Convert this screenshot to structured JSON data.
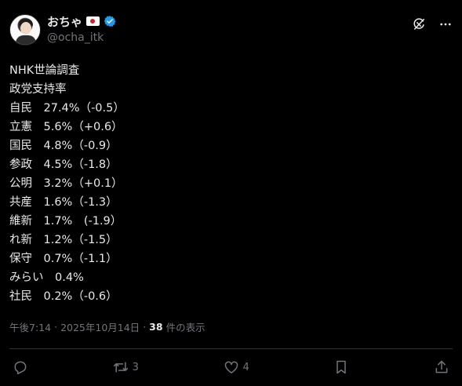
{
  "author": {
    "display_name": "おちゃ",
    "handle": "@ocha_itk"
  },
  "post": {
    "lines": [
      "NHK世論調査",
      "政党支持率",
      "自民　27.4%（-0.5）",
      "立憲　5.6%（+0.6）",
      "国民　4.8%（-0.9）",
      "参政　4.5%（-1.8）",
      "公明　3.2%（+0.1）",
      "共産　1.6%（-1.3）",
      "維新　1.7%　(-1.9）",
      "れ新　1.2%（-1.5）",
      "保守　0.7%（-1.1）",
      "みらい　0.4%",
      "社民　0.2%（-0.6）"
    ]
  },
  "meta": {
    "time": "午後7:14",
    "separator": "·",
    "date": "2025年10月14日",
    "views_count": "38",
    "views_label": "件の表示"
  },
  "actions": {
    "retweet_count": "3",
    "like_count": "4"
  },
  "icons": {
    "grok": "grok-icon",
    "more": "more-icon",
    "reply": "reply-icon",
    "retweet": "retweet-icon",
    "like": "like-icon",
    "bookmark": "bookmark-icon",
    "share": "share-icon",
    "verified": "verified-badge-icon",
    "flag": "japan-flag-icon"
  },
  "colors": {
    "background": "#000000",
    "text": "#e7e9ea",
    "muted": "#71767b",
    "verified": "#1d9bf0",
    "divider": "#2f3336"
  }
}
